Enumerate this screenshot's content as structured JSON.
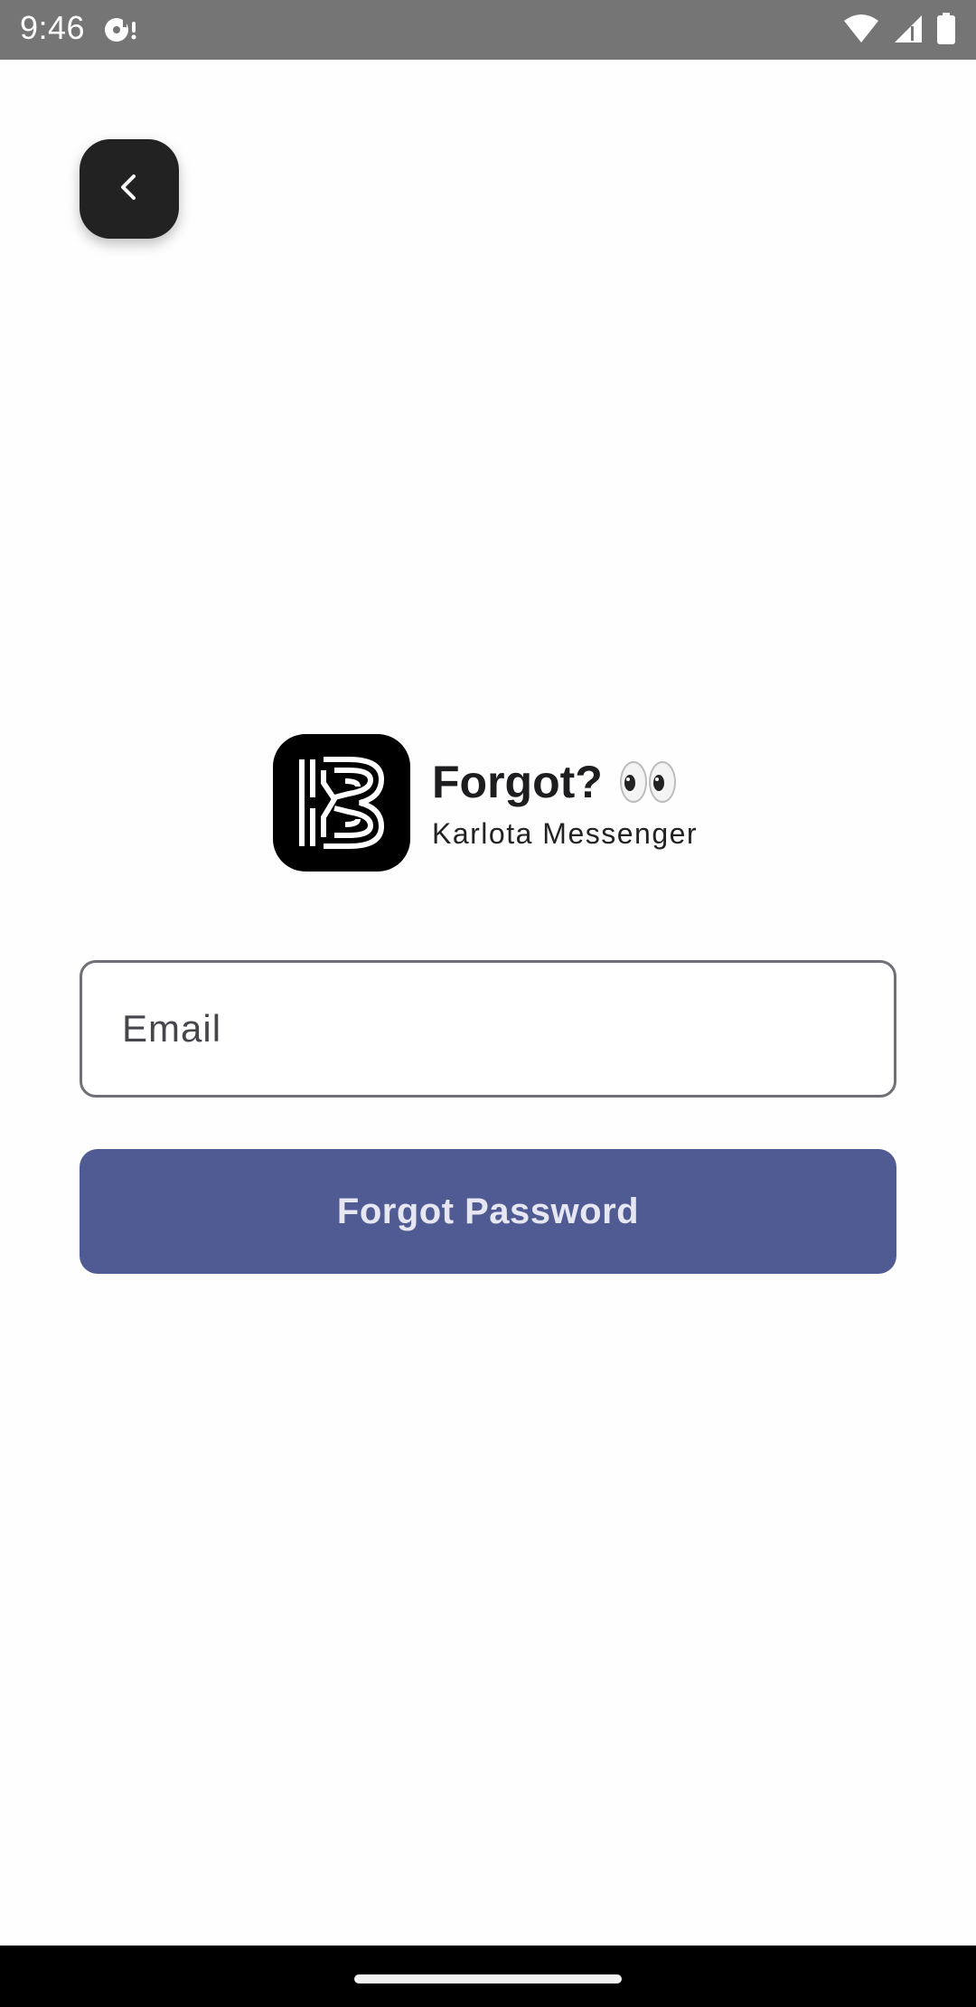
{
  "status_bar": {
    "time": "9:46",
    "icons": [
      "media-notification-icon",
      "wifi-icon",
      "cell-signal-icon",
      "battery-icon"
    ]
  },
  "back_button": {
    "icon": "chevron-left-icon"
  },
  "brand": {
    "logo_icon": "karlota-logo-icon",
    "title": "Forgot?",
    "emoji_icon": "eyes-emoji-icon",
    "subtitle": "Karlota Messenger"
  },
  "form": {
    "email_placeholder": "Email",
    "submit_label": "Forgot Password"
  },
  "colors": {
    "status_bar": "#757575",
    "back_button": "#222222",
    "primary_button": "#505b93",
    "primary_button_text": "#e6e7f2",
    "field_border": "#6f6f76",
    "nav_bar": "#000000"
  }
}
